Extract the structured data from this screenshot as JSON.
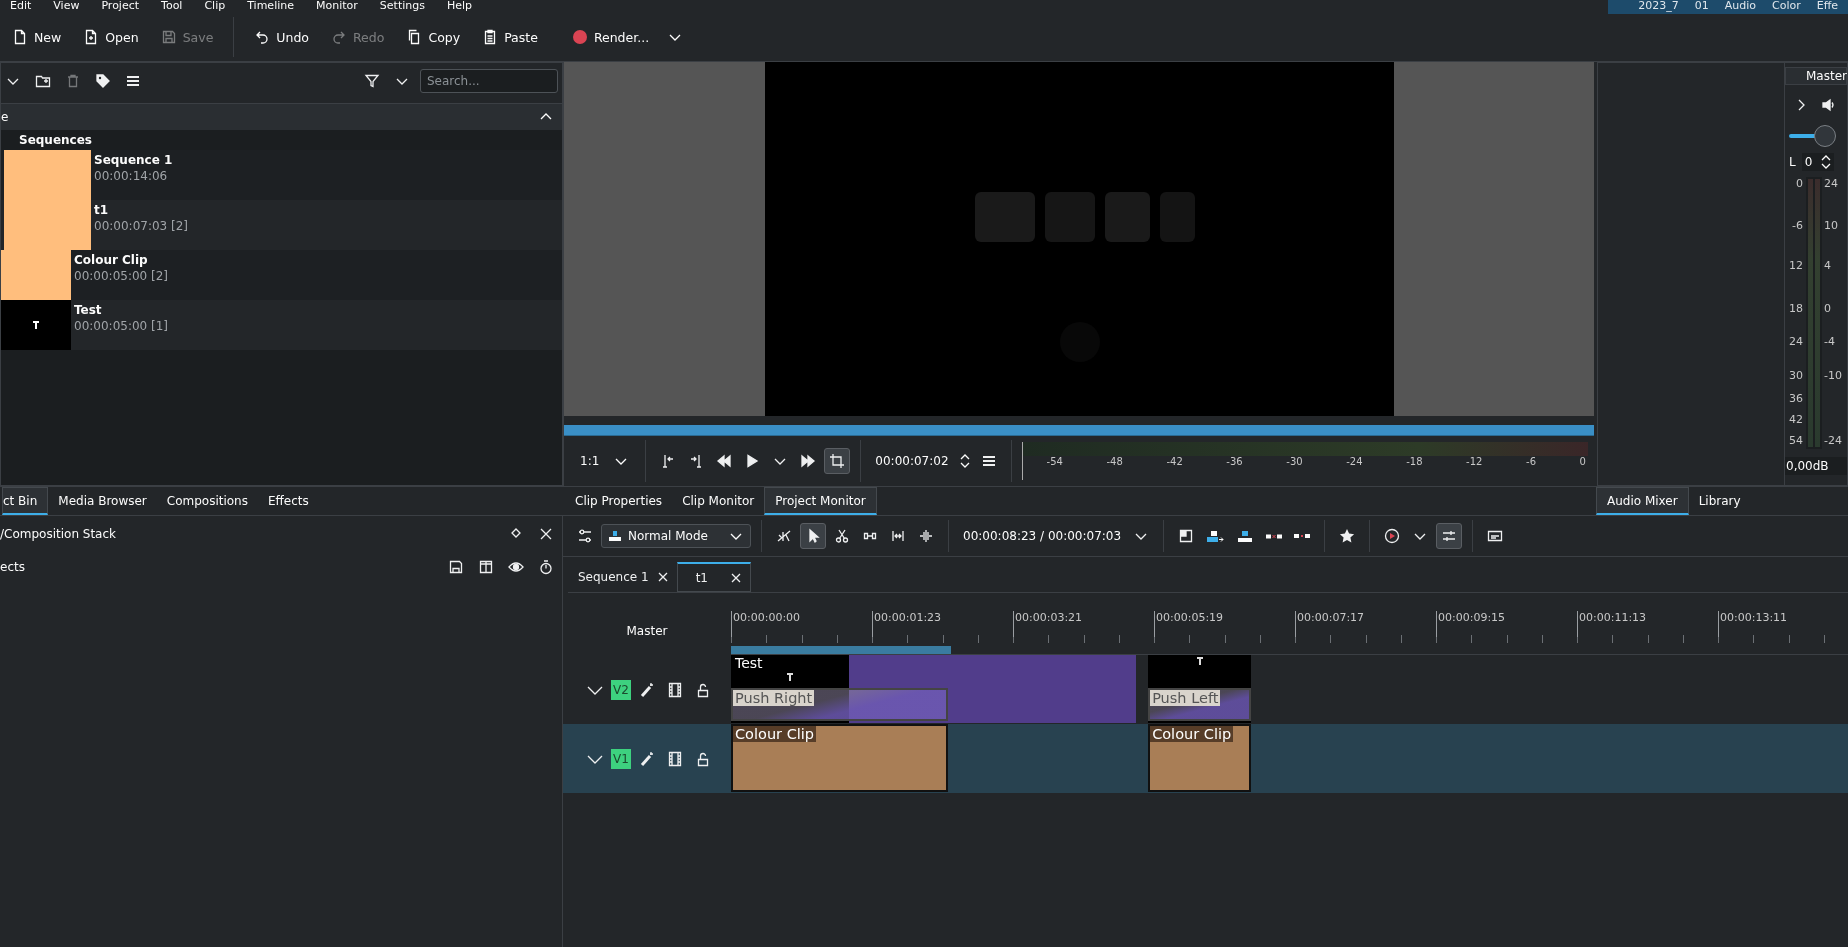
{
  "menu_bar": {
    "items": [
      "Edit",
      "View",
      "Project",
      "Tool",
      "Clip",
      "Timeline",
      "Monitor",
      "Settings",
      "Help"
    ],
    "layouts": [
      "2023_7",
      "01",
      "Audio",
      "Color",
      "Effe"
    ]
  },
  "toolbar": [
    {
      "label": "New",
      "disabled": false
    },
    {
      "label": "Open",
      "disabled": false
    },
    {
      "label": "Save",
      "disabled": true
    },
    {
      "label": "Undo",
      "disabled": false
    },
    {
      "label": "Redo",
      "disabled": true
    },
    {
      "label": "Copy",
      "disabled": false
    },
    {
      "label": "Paste",
      "disabled": false
    },
    {
      "label": "Render...",
      "disabled": false
    }
  ],
  "project_bin": {
    "search": {
      "placeholder": "Search..."
    },
    "column_header": "e",
    "folders": [
      {
        "name": "Sequences",
        "children": [
          {
            "name": "Sequence 1",
            "info": "00:00:14:06",
            "kind": "sequence"
          },
          {
            "name": "t1",
            "info": "00:00:07:03 [2]",
            "kind": "sequence"
          }
        ]
      }
    ],
    "clips": [
      {
        "name": "Colour Clip",
        "info": "00:00:05:00 [2]",
        "kind": "color"
      },
      {
        "name": "Test",
        "info": "00:00:05:00 [1]",
        "kind": "title"
      }
    ]
  },
  "left_tabs": [
    {
      "label": "ct Bin",
      "selected": true
    },
    {
      "label": "Media Browser",
      "selected": false
    },
    {
      "label": "Compositions",
      "selected": false
    },
    {
      "label": "Effects",
      "selected": false
    }
  ],
  "effect_stack": {
    "title": "/Composition Stack",
    "label": "ects"
  },
  "monitor": {
    "zoom": "1:1",
    "timecode": "00:00:07:02",
    "meter_scale": [
      "-54",
      "-48",
      "-42",
      "-36",
      "-30",
      "-24",
      "-18",
      "-12",
      "-6",
      "0"
    ]
  },
  "monitor_tabs": [
    {
      "label": "Clip Properties",
      "selected": false
    },
    {
      "label": "Clip Monitor",
      "selected": false
    },
    {
      "label": "Project Monitor",
      "selected": true
    }
  ],
  "mixer": {
    "channel": "Master",
    "balance_label": "L",
    "balance": "0",
    "level": 0.4,
    "db_scale": [
      "0",
      "-6",
      "12",
      "18",
      "24",
      "30",
      "36",
      "42",
      "54"
    ],
    "gain_scale": [
      "24",
      "10",
      "4",
      "0",
      "-4",
      "-10",
      "-24"
    ],
    "reading": "0,00dB"
  },
  "right_tabs": [
    {
      "label": "Audio Mixer",
      "selected": true
    },
    {
      "label": "Library",
      "selected": false
    }
  ],
  "timeline": {
    "mode": "Normal Mode",
    "timecode": "00:00:08:23 / 00:00:07:03",
    "tabs": [
      {
        "label": "Sequence 1",
        "selected": false
      },
      {
        "label": "t1",
        "selected": true
      }
    ],
    "master": "Master",
    "ruler": [
      "00:00:00:00",
      "00:00:01:23",
      "00:00:03:21",
      "00:00:05:19",
      "00:00:07:17",
      "00:00:09:15",
      "00:00:11:13",
      "00:00:13:11"
    ],
    "tracks": [
      {
        "name": "V2",
        "selected": false,
        "clips": [
          {
            "kind": "title",
            "name": "Test"
          },
          {
            "kind": "empty"
          },
          {
            "kind": "title"
          }
        ],
        "compositions": [
          {
            "name": "Push Right"
          },
          {
            "name": "Push Left"
          }
        ]
      },
      {
        "name": "V1",
        "selected": true,
        "clips": [
          {
            "kind": "color",
            "name": "Colour Clip"
          },
          {
            "kind": "color",
            "name": "Colour Clip"
          }
        ]
      }
    ]
  }
}
